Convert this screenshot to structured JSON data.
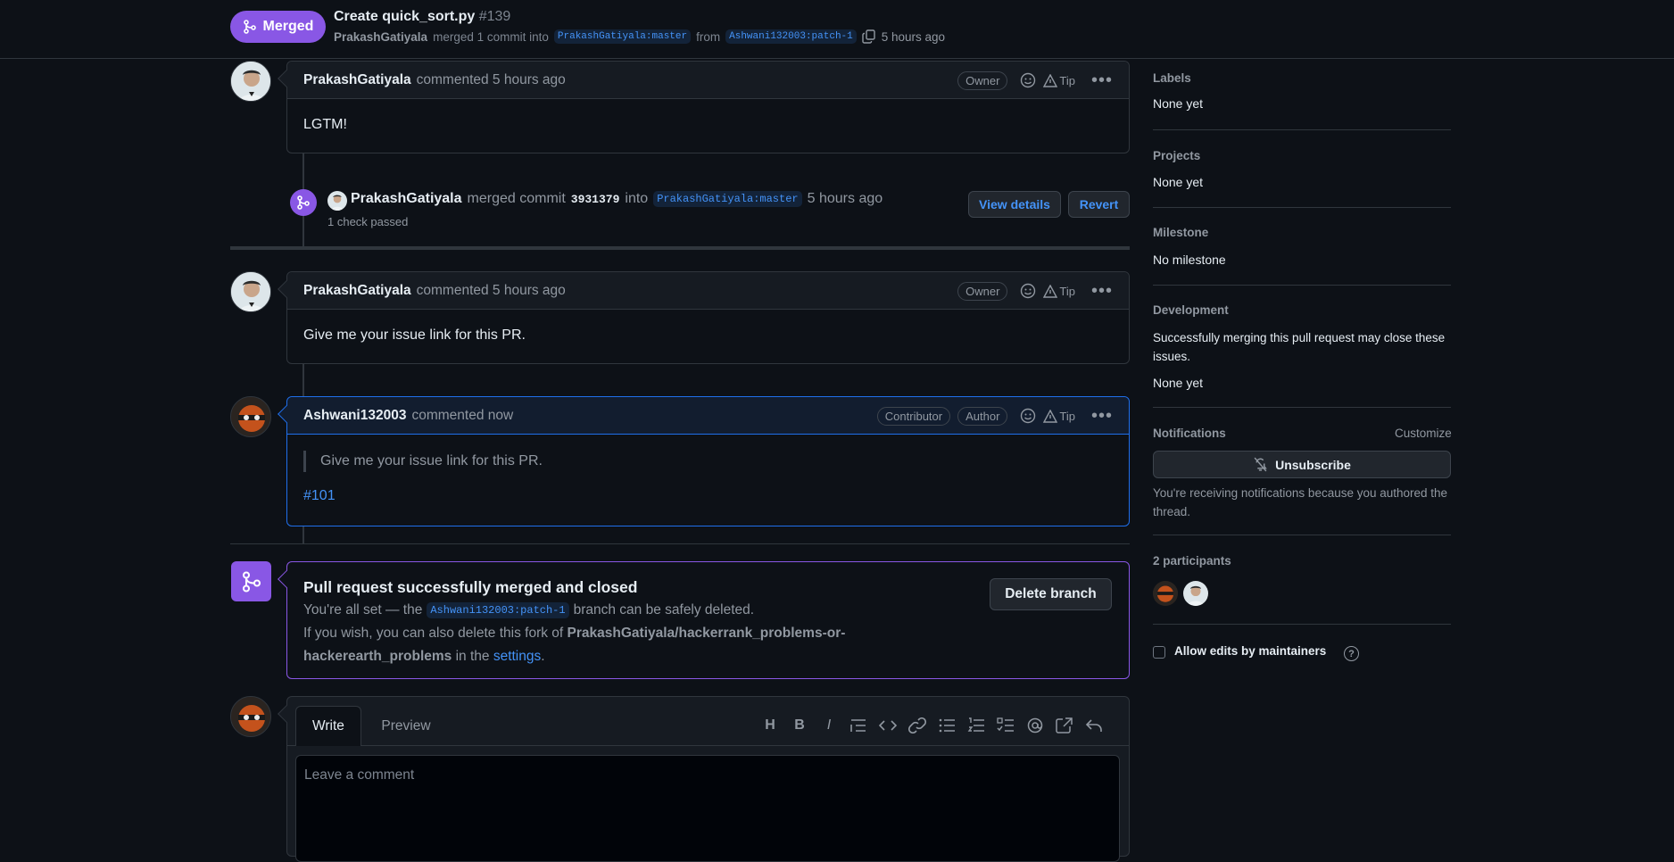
{
  "header": {
    "status": "Merged",
    "title": "Create quick_sort.py",
    "number": "#139",
    "author": "PrakashGatiyala",
    "merged_text": "merged 1 commit into",
    "base_branch": "PrakashGatiyala:master",
    "from_text": "from",
    "head_branch": "Ashwani132003:patch-1",
    "time": "5 hours ago"
  },
  "comments": [
    {
      "author": "PrakashGatiyala",
      "action": "commented 5 hours ago",
      "badges": [
        "Owner"
      ],
      "tip": "Tip",
      "body": "LGTM!"
    },
    {
      "author": "PrakashGatiyala",
      "action": "commented 5 hours ago",
      "badges": [
        "Owner"
      ],
      "tip": "Tip",
      "body": "Give me your issue link for this PR."
    },
    {
      "author": "Ashwani132003",
      "action": "commented now",
      "badges": [
        "Contributor",
        "Author"
      ],
      "tip": "Tip",
      "quote": "Give me your issue link for this PR.",
      "link": "#101"
    }
  ],
  "merge_event": {
    "author": "PrakashGatiyala",
    "text": "merged commit",
    "commit": "3931379",
    "into": "into",
    "branch": "PrakashGatiyala:master",
    "time": "5 hours ago",
    "checks": "1 check passed",
    "view_details": "View details",
    "revert": "Revert"
  },
  "merged_box": {
    "title": "Pull request successfully merged and closed",
    "line1_a": "You're all set — the",
    "branch": "Ashwani132003:patch-1",
    "line1_b": "branch can be safely deleted.",
    "line2_a": "If you wish, you can also delete this fork of",
    "repo_a": "PrakashGatiyala/hackerrank_problems-or-",
    "repo_b": "hackerearth_problems",
    "line2_b": "in the",
    "settings": "settings",
    "period": ".",
    "delete_button": "Delete branch"
  },
  "editor": {
    "tab_write": "Write",
    "tab_preview": "Preview",
    "placeholder": "Leave a comment",
    "toolbar_heading": "H",
    "toolbar_bold": "B",
    "toolbar_italic": "I"
  },
  "sidebar": {
    "labels_title": "Labels",
    "labels_value": "None yet",
    "projects_title": "Projects",
    "projects_value": "None yet",
    "milestone_title": "Milestone",
    "milestone_value": "No milestone",
    "development_title": "Development",
    "development_desc": "Successfully merging this pull request may close these issues.",
    "development_value": "None yet",
    "notifications_title": "Notifications",
    "customize": "Customize",
    "unsubscribe": "Unsubscribe",
    "notifications_desc": "You're receiving notifications because you authored the thread.",
    "participants_title": "2 participants",
    "allow_edits": "Allow edits by maintainers"
  },
  "colors": {
    "merged": "#8957e5",
    "link": "#4493f8",
    "bg": "#0d1117"
  }
}
